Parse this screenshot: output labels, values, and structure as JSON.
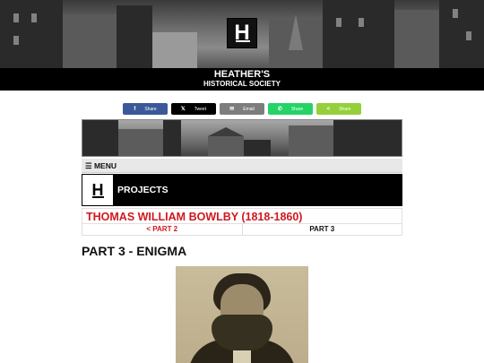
{
  "site": {
    "title": "HEATHER'S",
    "subtitle": "HISTORICAL SOCIETY",
    "logo_letter": "H"
  },
  "share_buttons": [
    {
      "name": "facebook",
      "icon": "f",
      "label": "Share",
      "color": "#3b5998"
    },
    {
      "name": "twitter",
      "icon": "𝕏",
      "label": "Tweet",
      "color": "#000000"
    },
    {
      "name": "email",
      "icon": "✉",
      "label": "Email",
      "color": "#7d7d7d"
    },
    {
      "name": "whatsapp",
      "icon": "✆",
      "label": "Share",
      "color": "#25d366"
    },
    {
      "name": "sharethis",
      "icon": "<",
      "label": "Share",
      "color": "#95d03a"
    }
  ],
  "menu": {
    "label": "☰ MENU"
  },
  "section": {
    "logo_letter": "H",
    "label": "PROJECTS"
  },
  "page": {
    "subject": "THOMAS WILLIAM BOWLBY (1818-1860)",
    "prev_link": "< PART 2",
    "current": "PART 3",
    "heading": "PART 3 - ENIGMA"
  },
  "colors": {
    "accent_red": "#d0181f",
    "bar_black": "#000000"
  }
}
